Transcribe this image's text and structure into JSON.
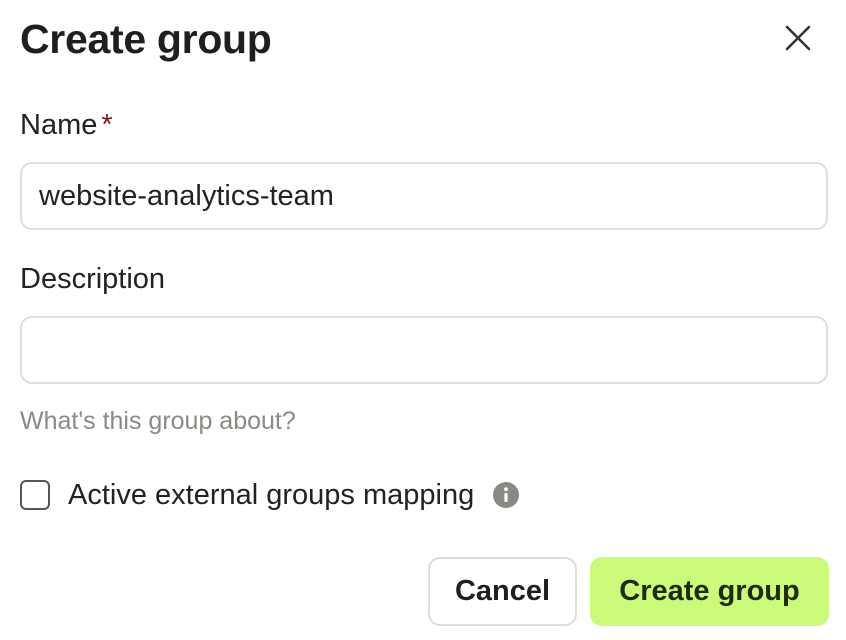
{
  "dialog": {
    "title": "Create group",
    "close_icon": "close-icon"
  },
  "form": {
    "name": {
      "label": "Name",
      "required_mark": "*",
      "value": "website-analytics-team"
    },
    "description": {
      "label": "Description",
      "value": "",
      "hint": "What's this group about?"
    },
    "external_mapping": {
      "label": "Active external groups mapping",
      "checked": false,
      "info_icon": "info-icon"
    }
  },
  "actions": {
    "cancel_label": "Cancel",
    "create_label": "Create group"
  },
  "colors": {
    "primary_button": "#cbf97a",
    "required_star": "#7a1d1d"
  }
}
